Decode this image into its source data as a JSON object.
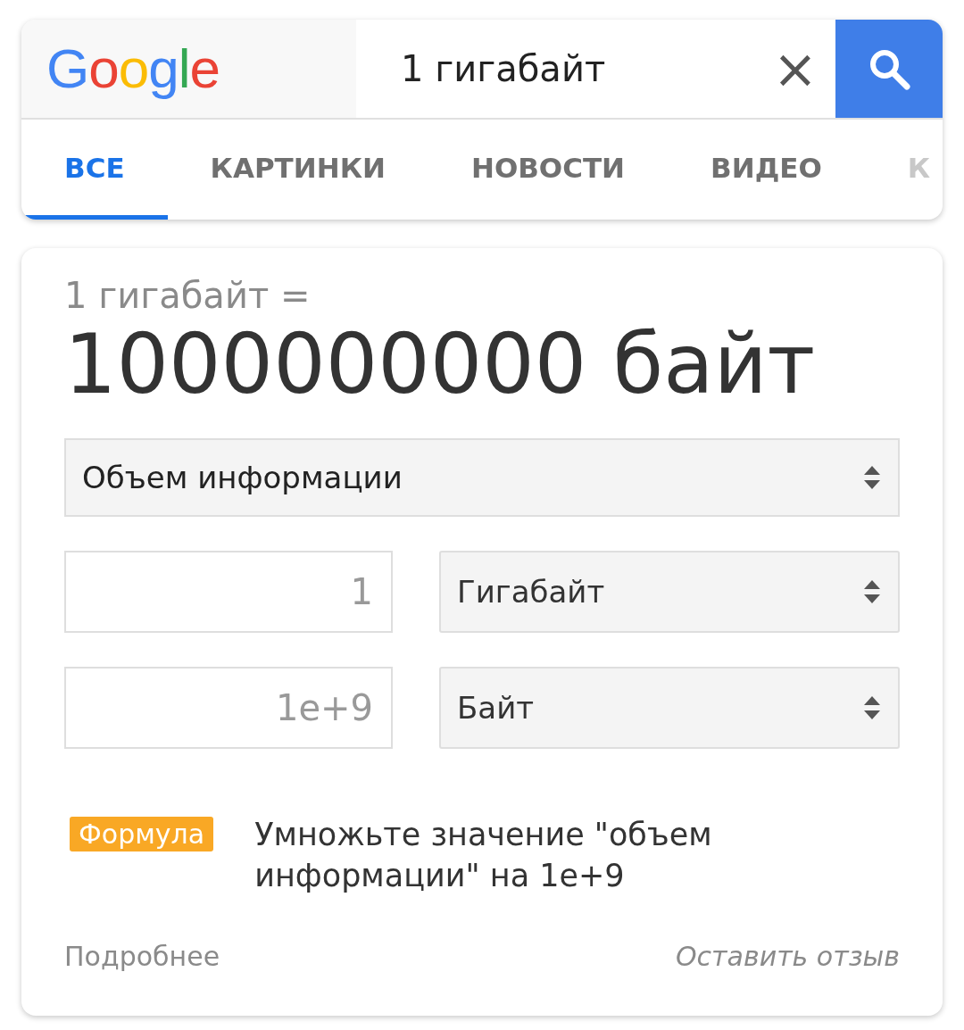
{
  "search": {
    "logo": "Google",
    "query": "1 гигабайт",
    "clear_icon": "×"
  },
  "tabs": [
    {
      "label": "ВСЕ",
      "selected": true
    },
    {
      "label": "КАРТИНКИ",
      "selected": false
    },
    {
      "label": "НОВОСТИ",
      "selected": false
    },
    {
      "label": "ВИДЕО",
      "selected": false
    },
    {
      "label": "К",
      "selected": false
    }
  ],
  "converter": {
    "equation": "1 гигабайт =",
    "result": "1000000000 байт",
    "category": "Объем информации",
    "rows": [
      {
        "value": "1",
        "unit": "Гигабайт"
      },
      {
        "value": "1e+9",
        "unit": "Байт"
      }
    ],
    "formula_badge": "Формула",
    "formula": "Умножьте значение \"объем информации\" на 1e+9",
    "more_link": "Подробнее",
    "feedback_link": "Оставить отзыв"
  }
}
